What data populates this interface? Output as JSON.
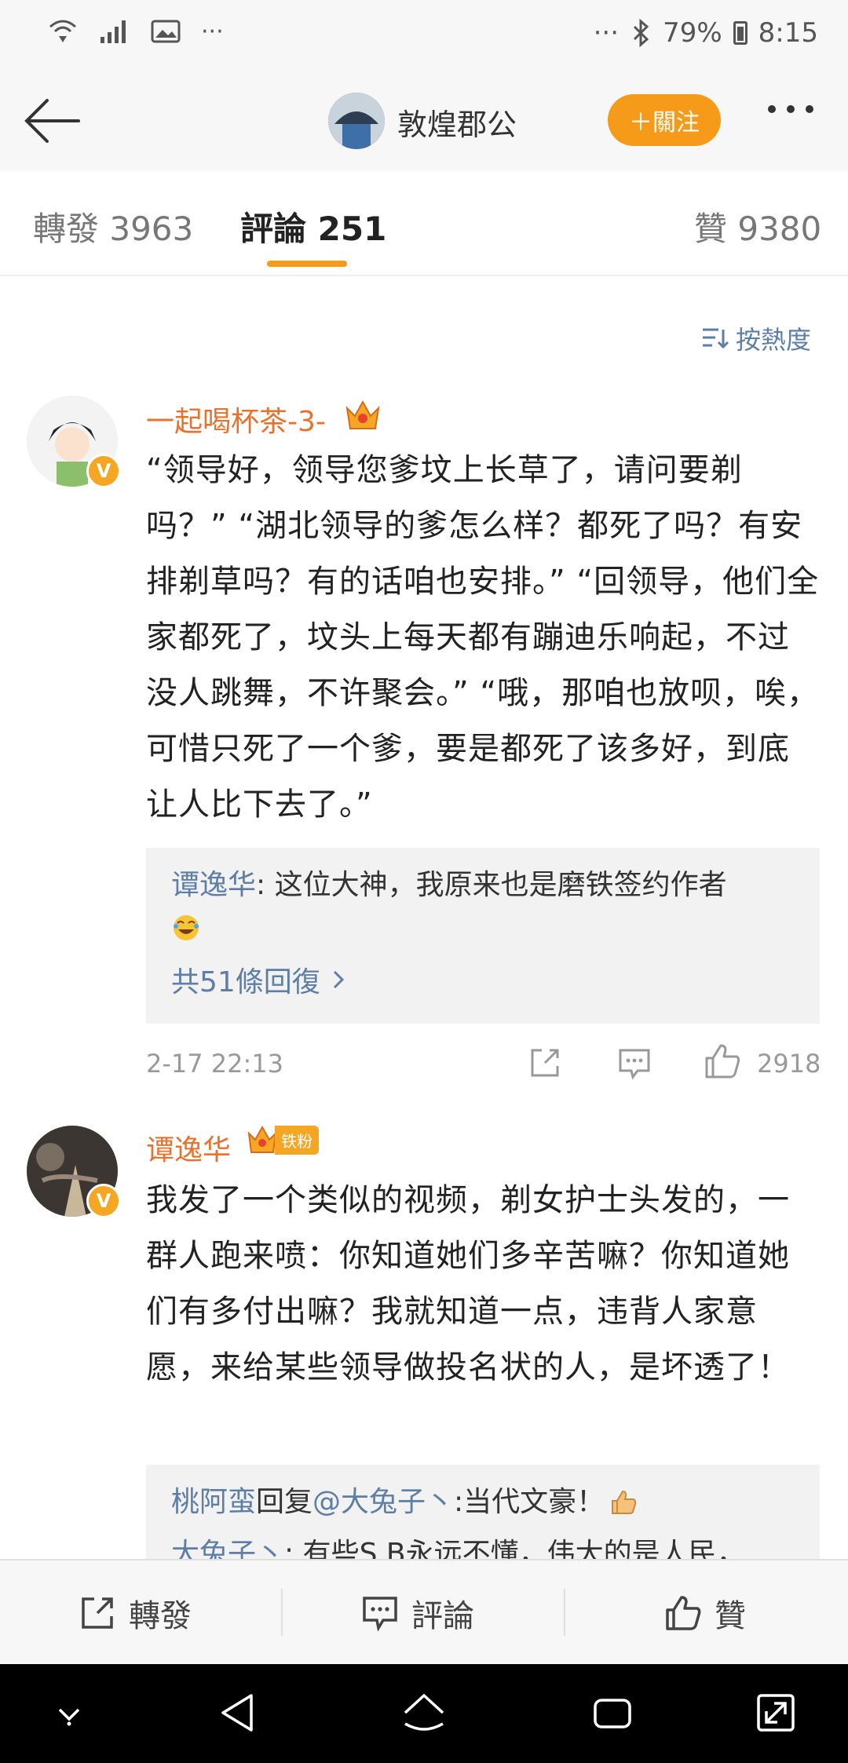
{
  "status_bar": {
    "dots_left": "···",
    "dots_right": "···",
    "battery_percent": "79%",
    "time": "8:15"
  },
  "header": {
    "user_name": "敦煌郡公",
    "follow_label": "＋關注"
  },
  "tabs": {
    "repost": "轉發 3963",
    "comments": "評論 251",
    "likes": "贊 9380"
  },
  "sort_label": "按熱度",
  "comments": [
    {
      "user": "一起喝杯茶-3-",
      "text": "“领导好，领导您爹坟上长草了，请问要剃吗？” “湖北领导的爹怎么样？都死了吗？有安排剃草吗？有的话咱也安排。” “回领导，他们全家都死了，坟头上每天都有蹦迪乐响起，不过没人跳舞，不许聚会。” “哦，那咱也放呗，唉，可惜只死了一个爹，要是都死了该多好，到底让人比下去了。”",
      "reply_user": "谭逸华",
      "reply_text": ": 这位大神，我原来也是磨铁签约作者",
      "more_replies": "共51條回復",
      "time": "2-17 22:13",
      "likes": "2918"
    },
    {
      "user": "谭逸华",
      "badge": "铁粉",
      "text": "我发了一个类似的视频，剃女护士头发的，一群人跑来喷：你知道她们多辛苦嘛？你知道她们有多付出嘛？我就知道一点，违背人家意愿，来给某些领导做投名状的人，是坏透了！",
      "reply1_user": "桃阿蛮",
      "reply1_mid": "回复",
      "reply1_mention": "@大兔子丶",
      "reply1_text": ":当代文豪！",
      "reply2_user": "大兔子丶",
      "reply2_text": ": 有些S B永远不懂，伟大的是人民，"
    }
  ],
  "bottom_bar": {
    "repost": "轉發",
    "comment": "評論",
    "like": "贊"
  }
}
